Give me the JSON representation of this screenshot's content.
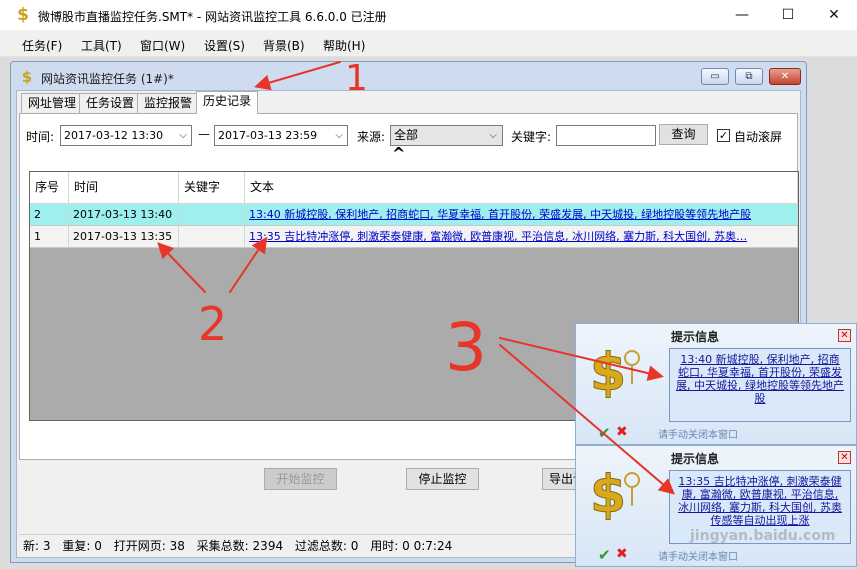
{
  "window": {
    "icon": "dollar-icon",
    "title": "微博股市直播监控任务.SMT* - 网站资讯监控工具 6.6.0.0  已注册",
    "controls": {
      "minimize": "—",
      "maximize": "☐",
      "close": "✕"
    }
  },
  "menu": [
    "任务(F)",
    "工具(T)",
    "窗口(W)",
    "设置(S)",
    "背景(B)",
    "帮助(H)"
  ],
  "child": {
    "icon": "dollar-icon",
    "title": "网站资讯监控任务   (1#)*",
    "controls": {
      "minimize": "▭",
      "restore": "⧉",
      "close": "✕"
    }
  },
  "tabs": [
    "网址管理",
    "任务设置",
    "监控报警",
    "历史记录"
  ],
  "active_tab": 3,
  "filter": {
    "time_label": "时间:",
    "from": "2017-03-12  13:30",
    "dash": "—",
    "to": "2017-03-13  23:59",
    "source_label": "来源:",
    "source_value": "全部",
    "keyword_label": "关键字:",
    "keyword_value": "",
    "query_button": "查询",
    "autoscroll_label": "自动滚屏",
    "autoscroll_checked": true
  },
  "grid": {
    "columns": [
      "序号",
      "时间",
      "关键字",
      "文本"
    ],
    "rows": [
      {
        "id": "2",
        "time": "2017-03-13  13:40",
        "keyword": "",
        "text": "13:40  新城控股, 保利地产, 招商蛇口, 华夏幸福, 首开股份, 荣盛发展, 中天城投, 绿地控股等领先地产股",
        "selected": true
      },
      {
        "id": "1",
        "time": "2017-03-13  13:35",
        "keyword": "",
        "text": "13:35  吉比特冲涨停, 刺激荣泰健康, 富瀚微, 欧普康视, 平治信息, 冰川网络, 塞力斯, 科大国创, 苏奥…",
        "selected": false
      }
    ]
  },
  "buttons": {
    "start": "开始监控",
    "stop": "停止监控",
    "export": "导出记"
  },
  "status": {
    "new_label": "新:",
    "new": "3",
    "dup_label": "重复:",
    "dup": "0",
    "pages_label": "打开网页:",
    "pages": "38",
    "total_label": "采集总数:",
    "total": "2394",
    "filtered_label": "过滤总数:",
    "filtered": "0",
    "elapsed_label": "用时:",
    "elapsed": "0  0:7:24"
  },
  "popups": [
    {
      "title": "提示信息",
      "text": "13:40  新城控股, 保利地产, 招商蛇口, 华夏幸福, 首开股份, 荣盛发展, 中天城投, 绿地控股等领先地产股",
      "footer": "请手动关闭本窗口"
    },
    {
      "title": "提示信息",
      "text": "13:35  吉比特冲涨停, 刺激荣泰健康, 富瀚微, 欧普康视, 平治信息, 冰川网络, 塞力斯, 科大国创, 苏奥传感等自动出现上涨",
      "footer": "请手动关闭本窗口"
    }
  ],
  "annotations": {
    "label1": "1",
    "label2": "2",
    "label3": "3",
    "color": "#e8352a"
  },
  "watermark": "jingyan.baidu.com"
}
